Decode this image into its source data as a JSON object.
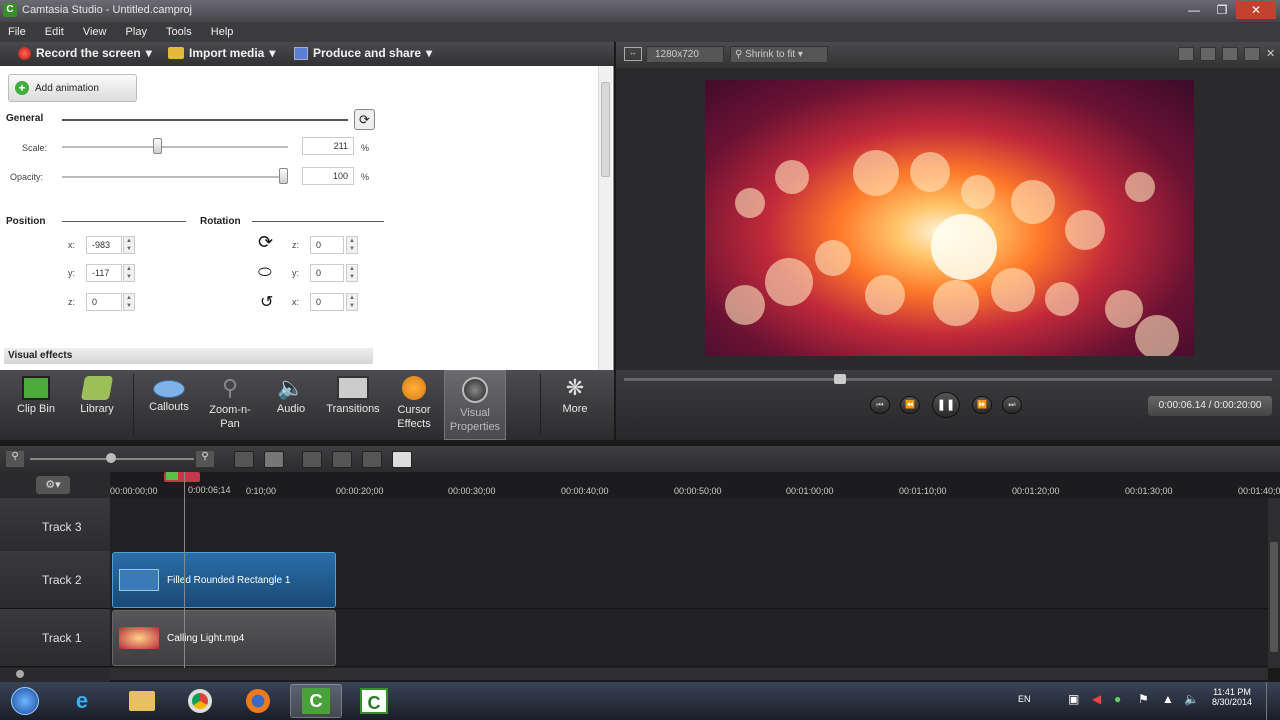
{
  "window": {
    "title": "Camtasia Studio - Untitled.camproj",
    "app_letter": "C"
  },
  "menu": [
    "File",
    "Edit",
    "View",
    "Play",
    "Tools",
    "Help"
  ],
  "toolbar": {
    "record": "Record the screen",
    "import": "Import media",
    "produce": "Produce and share"
  },
  "properties": {
    "add_animation": "Add animation",
    "general": "General",
    "scale_label": "Scale:",
    "scale_value": "211",
    "scale_unit": "%",
    "scale_level": 0.42,
    "opacity_label": "Opacity:",
    "opacity_value": "100",
    "opacity_unit": "%",
    "opacity_level": 1.0,
    "position": "Position",
    "rotation": "Rotation",
    "pos_x_label": "x:",
    "pos_x": "-983",
    "pos_y_label": "y:",
    "pos_y": "-117",
    "pos_z_label": "z:",
    "pos_z": "0",
    "rot_z_label": "z:",
    "rot_z": "0",
    "rot_y_label": "y:",
    "rot_y": "0",
    "rot_x_label": "x:",
    "rot_x": "0",
    "visual_effects": "Visual effects"
  },
  "tabs": [
    {
      "label": "Clip Bin"
    },
    {
      "label": "Library"
    },
    {
      "label": "Callouts"
    },
    {
      "label": "Zoom-n-\nPan"
    },
    {
      "label": "Audio"
    },
    {
      "label": "Transitions"
    },
    {
      "label": "Cursor\nEffects"
    },
    {
      "label": "Visual\nProperties"
    },
    {
      "label": "More"
    }
  ],
  "preview": {
    "resolution": "1280x720",
    "zoom": "Shrink to fit",
    "time": "0:00:06.14 / 0:00:20:00",
    "scrub_level": 0.33
  },
  "timeline": {
    "playhead_label": "0:00:06;14",
    "ticks": [
      "00:00:00;00",
      "0:10;00",
      "00:00:20;00",
      "00:00:30;00",
      "00:00:40;00",
      "00:00:50;00",
      "00:01:00;00",
      "00:01:10;00",
      "00:01:20;00",
      "00:01:30;00",
      "00:01:40;00"
    ],
    "tracks": [
      {
        "name": "Track 3",
        "clip": ""
      },
      {
        "name": "Track 2",
        "clip": "Filled Rounded Rectangle 1"
      },
      {
        "name": "Track 1",
        "clip": "Calling Light.mp4"
      }
    ]
  },
  "taskbar": {
    "lang": "EN",
    "time": "11:41 PM",
    "date": "8/30/2014"
  },
  "colors": {
    "accent_blue": "#1e4f7a",
    "clip_gray": "#4a4a4c",
    "green": "#3a8d2e"
  }
}
